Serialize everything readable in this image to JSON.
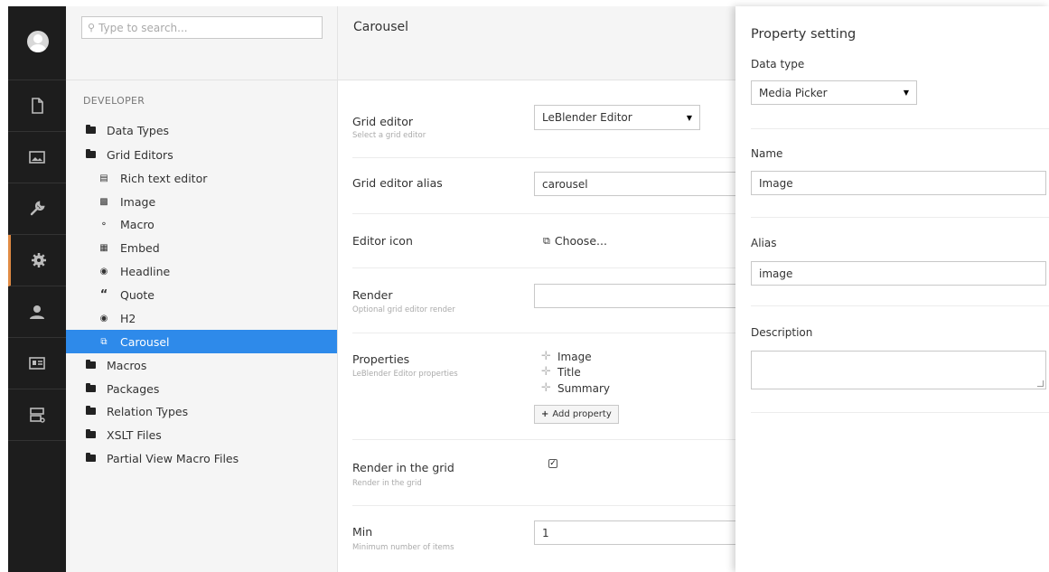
{
  "appbar": {
    "sections": [
      {
        "icon": "content-icon"
      },
      {
        "icon": "media-icon"
      },
      {
        "icon": "settings-wrench-icon"
      },
      {
        "icon": "developer-gear-icon",
        "active": true
      },
      {
        "icon": "users-icon"
      },
      {
        "icon": "members-icon"
      },
      {
        "icon": "forms-icon"
      }
    ],
    "active_color": "#e08a43"
  },
  "tree": {
    "search_placeholder": "Type to search...",
    "root_label": "DEVELOPER",
    "items": [
      {
        "label": "Data Types",
        "icon": "folder-icon"
      },
      {
        "label": "Grid Editors",
        "icon": "folder-icon"
      },
      {
        "label": "Rich text editor",
        "icon": "rte-icon"
      },
      {
        "label": "Image",
        "icon": "image-icon"
      },
      {
        "label": "Macro",
        "icon": "macro-icon"
      },
      {
        "label": "Embed",
        "icon": "embed-icon"
      },
      {
        "label": "Headline",
        "icon": "headline-icon"
      },
      {
        "label": "Quote",
        "icon": "quote-icon"
      },
      {
        "label": "H2",
        "icon": "headline-icon"
      },
      {
        "label": "Carousel",
        "icon": "carousel-icon",
        "selected": true
      },
      {
        "label": "Macros",
        "icon": "folder-icon"
      },
      {
        "label": "Packages",
        "icon": "folder-icon"
      },
      {
        "label": "Relation Types",
        "icon": "folder-icon"
      },
      {
        "label": "XSLT Files",
        "icon": "folder-icon"
      },
      {
        "label": "Partial View Macro Files",
        "icon": "folder-icon"
      }
    ],
    "selected_color": "#2e8aea"
  },
  "editor": {
    "title": "Carousel",
    "grid_editor": {
      "label": "Grid editor",
      "sublabel": "Select a grid editor",
      "value": "LeBlender Editor"
    },
    "alias": {
      "label": "Grid editor alias",
      "value": "carousel"
    },
    "icon": {
      "label": "Editor icon",
      "choose": "Choose..."
    },
    "render": {
      "label": "Render",
      "sublabel": "Optional grid editor render",
      "value": ""
    },
    "properties": {
      "label": "Properties",
      "sublabel": "LeBlender Editor properties",
      "items": [
        "Image",
        "Title",
        "Summary"
      ],
      "add_button": "Add property"
    },
    "render_in_grid": {
      "label": "Render in the grid",
      "sublabel": "Render in the grid",
      "checked": true
    },
    "min": {
      "label": "Min",
      "sublabel": "Minimum number of items",
      "value": "1"
    }
  },
  "overlay": {
    "title": "Property setting",
    "data_type": {
      "label": "Data type",
      "value": "Media Picker"
    },
    "name": {
      "label": "Name",
      "value": "Image"
    },
    "alias": {
      "label": "Alias",
      "value": "image"
    },
    "description": {
      "label": "Description",
      "value": ""
    }
  }
}
